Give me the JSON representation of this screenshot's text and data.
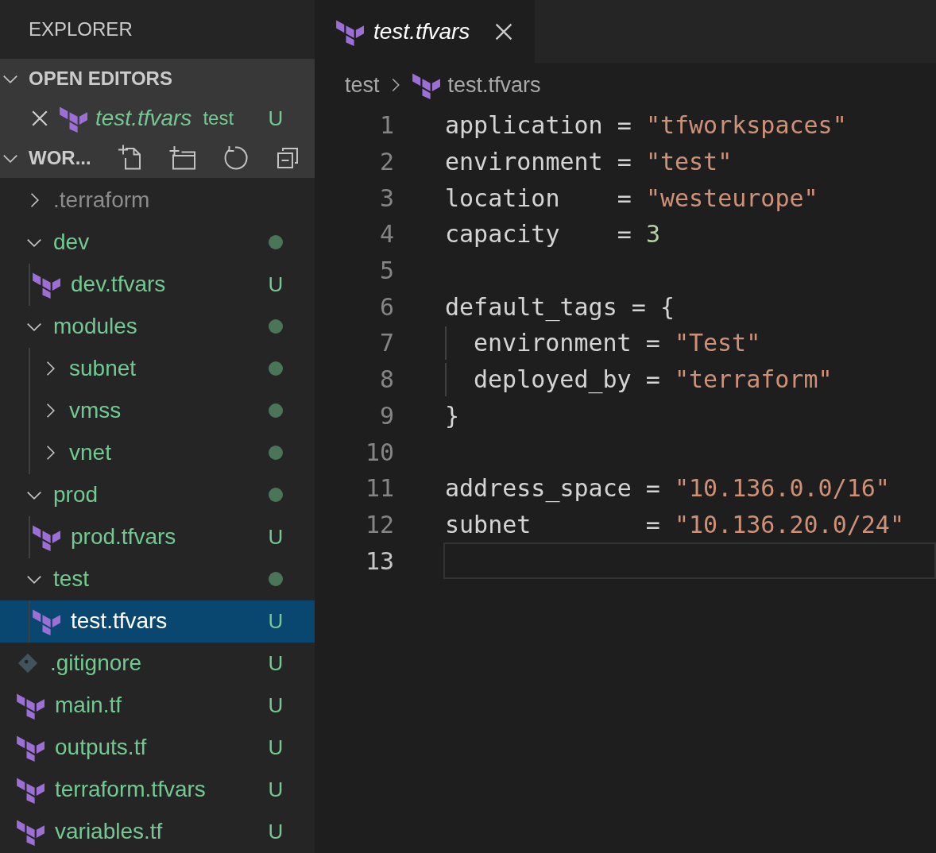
{
  "sidebar": {
    "title": "EXPLORER",
    "open_editors": {
      "title": "OPEN EDITORS",
      "expanded": true,
      "items": [
        {
          "name": "test.tfvars",
          "folder": "test",
          "badge": "U",
          "kind": "tf_file"
        }
      ]
    },
    "workspace": {
      "title": "WOR...",
      "expanded": true
    },
    "tree": [
      {
        "label": ".terraform",
        "kind": "folder",
        "expanded": false,
        "ignored": true
      },
      {
        "label": "dev",
        "kind": "folder",
        "expanded": true,
        "dot": true,
        "children": [
          {
            "label": "dev.tfvars",
            "kind": "tf_file",
            "badge": "U",
            "selected": false
          }
        ]
      },
      {
        "label": "modules",
        "kind": "folder",
        "expanded": true,
        "dot": true,
        "children": [
          {
            "label": "subnet",
            "kind": "folder",
            "expanded": false,
            "dot": true
          },
          {
            "label": "vmss",
            "kind": "folder",
            "expanded": false,
            "dot": true
          },
          {
            "label": "vnet",
            "kind": "folder",
            "expanded": false,
            "dot": true
          }
        ]
      },
      {
        "label": "prod",
        "kind": "folder",
        "expanded": true,
        "dot": true,
        "children": [
          {
            "label": "prod.tfvars",
            "kind": "tf_file",
            "badge": "U",
            "selected": false
          }
        ]
      },
      {
        "label": "test",
        "kind": "folder",
        "expanded": true,
        "dot": true,
        "children": [
          {
            "label": "test.tfvars",
            "kind": "tf_file",
            "badge": "U",
            "selected": true
          }
        ]
      },
      {
        "label": ".gitignore",
        "kind": "git_file",
        "badge": "U",
        "selected": false
      },
      {
        "label": "main.tf",
        "kind": "tf_file",
        "badge": "U",
        "selected": false
      },
      {
        "label": "outputs.tf",
        "kind": "tf_file",
        "badge": "U",
        "selected": false
      },
      {
        "label": "terraform.tfvars",
        "kind": "tf_file",
        "badge": "U",
        "selected": false
      },
      {
        "label": "variables.tf",
        "kind": "tf_file",
        "badge": "U",
        "selected": false
      }
    ]
  },
  "tabs": [
    {
      "title": "test.tfvars",
      "selected": true
    }
  ],
  "breadcrumbs": [
    "test",
    "test.tfvars"
  ],
  "code": [
    {
      "number": "1",
      "tokens": [
        {
          "kind": "key",
          "text": "application"
        },
        {
          "kind": "op",
          "text": " = "
        },
        {
          "kind": "string",
          "text": "\"tfworkspaces\""
        }
      ]
    },
    {
      "number": "2",
      "tokens": [
        {
          "kind": "key",
          "text": "environment"
        },
        {
          "kind": "op",
          "text": " = "
        },
        {
          "kind": "string",
          "text": "\"test\""
        }
      ]
    },
    {
      "number": "3",
      "tokens": [
        {
          "kind": "key",
          "text": "location"
        },
        {
          "kind": "op",
          "text": "    = "
        },
        {
          "kind": "string",
          "text": "\"westeurope\""
        }
      ]
    },
    {
      "number": "4",
      "tokens": [
        {
          "kind": "key",
          "text": "capacity"
        },
        {
          "kind": "op",
          "text": "    = "
        },
        {
          "kind": "number",
          "text": "3"
        }
      ]
    },
    {
      "number": "5"
    },
    {
      "number": "6",
      "tokens": [
        {
          "kind": "key",
          "text": "default_tags"
        },
        {
          "kind": "op",
          "text": " = {"
        }
      ]
    },
    {
      "number": "7",
      "indented": true,
      "tokens": [
        {
          "kind": "key",
          "text": "environment"
        },
        {
          "kind": "op",
          "text": " = "
        },
        {
          "kind": "string",
          "text": "\"Test\""
        }
      ]
    },
    {
      "number": "8",
      "indented": true,
      "tokens": [
        {
          "kind": "key",
          "text": "deployed_by"
        },
        {
          "kind": "op",
          "text": " = "
        },
        {
          "kind": "string",
          "text": "\"terraform\""
        }
      ]
    },
    {
      "number": "9",
      "tokens": [
        {
          "kind": "punct",
          "text": "}"
        }
      ]
    },
    {
      "number": "10"
    },
    {
      "number": "11",
      "tokens": [
        {
          "kind": "key",
          "text": "address_space"
        },
        {
          "kind": "op",
          "text": " = "
        },
        {
          "kind": "string",
          "text": "\"10.136.0.0/16\""
        }
      ]
    },
    {
      "number": "12",
      "tokens": [
        {
          "kind": "key",
          "text": "subnet"
        },
        {
          "kind": "op",
          "text": "        = "
        },
        {
          "kind": "string",
          "text": "\"10.136.20.0/24\""
        }
      ]
    },
    {
      "number": "13",
      "current": true
    }
  ]
}
